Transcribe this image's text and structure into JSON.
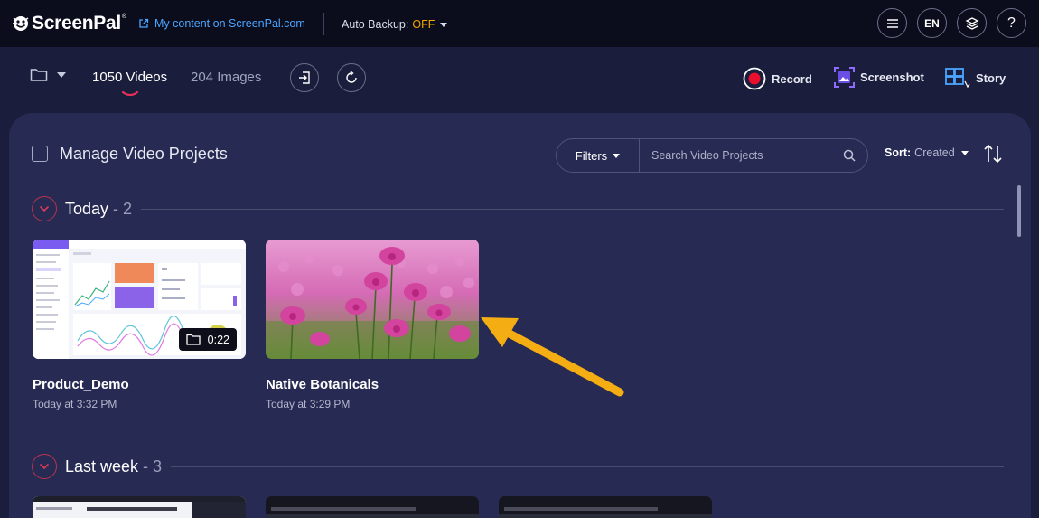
{
  "header": {
    "brand": "ScreenPal",
    "my_content_prefix": "My content on ",
    "my_content_link": "ScreenPal.com",
    "auto_backup_label": "Auto Backup:",
    "auto_backup_value": "OFF",
    "language": "EN",
    "help": "?",
    "colors": {
      "accent": "#4aa5ff",
      "backup_off": "#f5a300"
    }
  },
  "toolbar": {
    "tab_videos": "1050 Videos",
    "tab_images": "204 Images",
    "record_label": "Record",
    "screenshot_label": "Screenshot",
    "story_label": "Story"
  },
  "main": {
    "title": "Manage Video Projects",
    "filters_label": "Filters",
    "search_placeholder": "Search Video Projects",
    "sort_label": "Sort:",
    "sort_value": "Created",
    "sections": [
      {
        "title": "Today",
        "count": "- 2",
        "items": [
          {
            "title": "Product_Demo",
            "date": "Today at 3:32 PM",
            "duration": "0:22",
            "icon": "folder-icon"
          },
          {
            "title": "Native Botanicals",
            "date": "Today at 3:29 PM"
          }
        ]
      },
      {
        "title": "Last week",
        "count": "- 3"
      }
    ]
  }
}
